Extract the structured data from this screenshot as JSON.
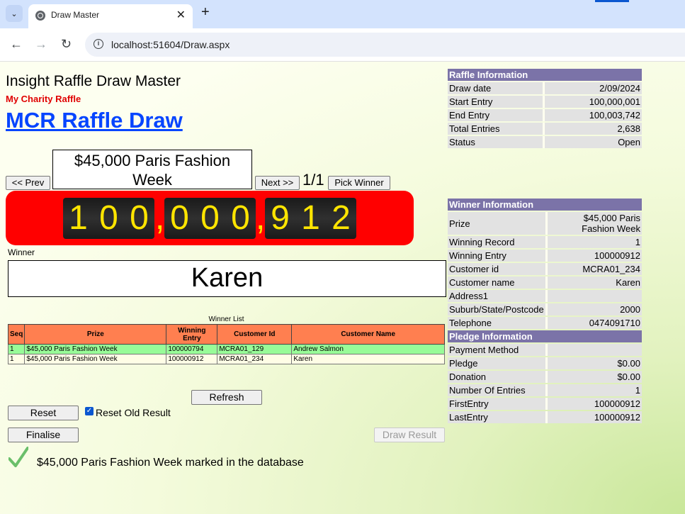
{
  "browser": {
    "tab_title": "Draw Master",
    "url": "localhost:51604/Draw.aspx"
  },
  "header": {
    "app_title": "Insight Raffle Draw Master",
    "charity_name": "My Charity Raffle",
    "draw_title": "MCR Raffle Draw"
  },
  "draw": {
    "prev_label": "<< Prev",
    "prize": "$45,000 Paris Fashion Week",
    "next_label": "Next >>",
    "counter": "1/1",
    "pick_winner_label": "Pick Winner",
    "number_groups": [
      [
        "1",
        "0",
        "0"
      ],
      [
        "0",
        "0",
        "0"
      ],
      [
        "9",
        "1",
        "2"
      ]
    ],
    "separator": ",",
    "winner_label": "Winner",
    "winner_name": "Karen"
  },
  "winner_list": {
    "caption": "Winner List",
    "headers": [
      "Seq",
      "Prize",
      "Winning Entry",
      "Customer Id",
      "Customer Name"
    ],
    "rows": [
      [
        "1",
        "$45,000 Paris Fashion Week",
        "100000794",
        "MCRA01_129",
        "Andrew Salmon"
      ],
      [
        "1",
        "$45,000 Paris Fashion Week",
        "100000912",
        "MCRA01_234",
        "Karen"
      ]
    ]
  },
  "controls": {
    "refresh_label": "Refresh",
    "reset_label": "Reset",
    "reset_old_label": "Reset Old Result",
    "reset_old_checked": true,
    "finalise_label": "Finalise",
    "draw_result_label": "Draw Result",
    "status_message": "$45,000 Paris Fashion Week marked in the database"
  },
  "raffle_info": {
    "title": "Raffle Information",
    "rows": [
      [
        "Draw date",
        "2/09/2024"
      ],
      [
        "Start Entry",
        "100,000,001"
      ],
      [
        "End Entry",
        "100,003,742"
      ],
      [
        "Total Entries",
        "2,638"
      ],
      [
        "Status",
        "Open"
      ]
    ]
  },
  "winner_info": {
    "title": "Winner Information",
    "rows": [
      [
        "Prize",
        "$45,000 Paris Fashion Week"
      ],
      [
        "Winning Record",
        "1"
      ],
      [
        "Winning Entry",
        "100000912"
      ],
      [
        "Customer id",
        "MCRA01_234"
      ],
      [
        "Customer name",
        "Karen"
      ],
      [
        "Address1",
        ""
      ],
      [
        "Suburb/State/Postcode",
        "2000"
      ],
      [
        "Telephone",
        "0474091710"
      ]
    ]
  },
  "pledge_info": {
    "title": "Pledge Information",
    "rows": [
      [
        "Payment Method",
        ""
      ],
      [
        "Pledge",
        "$0.00"
      ],
      [
        "Donation",
        "$0.00"
      ],
      [
        "Number Of Entries",
        "1"
      ],
      [
        "FirstEntry",
        "100000912"
      ],
      [
        "LastEntry",
        "100000912"
      ]
    ]
  },
  "colors": {
    "odometer_bg": "#ff0000",
    "digit_color": "#ffe500",
    "info_header_bg": "#7b73a8",
    "list_header_bg": "#ff7f50",
    "highlight_row_bg": "#98fb98"
  }
}
